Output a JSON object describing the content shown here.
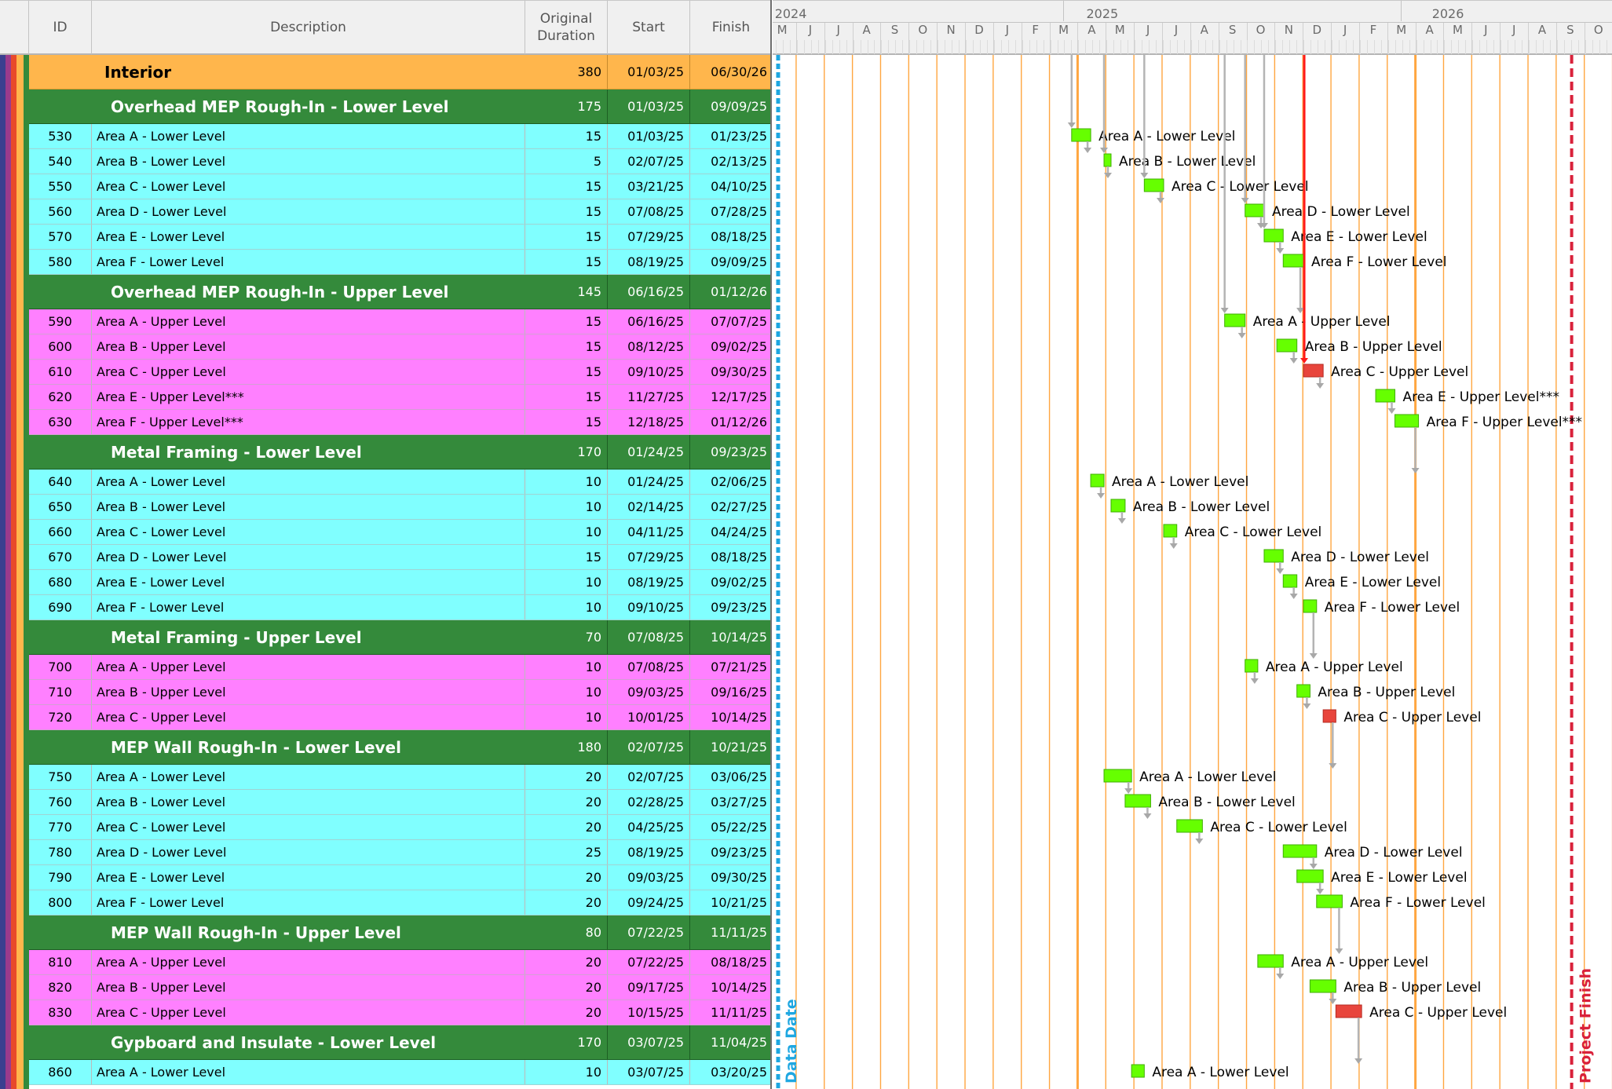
{
  "columns": {
    "id": "ID",
    "description": "Description",
    "duration_line1": "Original",
    "duration_line2": "Duration",
    "start": "Start",
    "finish": "Finish"
  },
  "timescale": {
    "years": [
      "2024",
      "2025",
      "2026"
    ],
    "months": [
      "M",
      "J",
      "J",
      "A",
      "S",
      "O",
      "N",
      "D",
      "J",
      "F",
      "M",
      "A",
      "M",
      "J",
      "J",
      "A",
      "S",
      "O",
      "N",
      "D",
      "J",
      "F",
      "M",
      "A",
      "M",
      "J",
      "J",
      "A",
      "S",
      "O"
    ]
  },
  "markers": {
    "data_date": "Data Date",
    "project_finish": "Project Finish"
  },
  "colors": {
    "wbs_level0": "#ffb64c",
    "wbs_level1": "#348a3b",
    "activity_lower": "#80ffff",
    "activity_upper": "#ff80ff",
    "bar_normal": "#66ff00",
    "bar_critical": "#e8453c",
    "data_date_line": "#1ea7e1",
    "project_finish_line": "#d9213a",
    "gridline": "#ffa640"
  },
  "rows": [
    {
      "type": "wbs0",
      "id": "",
      "description": "Interior",
      "duration": "380",
      "start": "01/03/25",
      "finish": "06/30/26"
    },
    {
      "type": "wbs1",
      "id": "",
      "description": "Overhead MEP Rough-In - Lower Level",
      "duration": "175",
      "start": "01/03/25",
      "finish": "09/09/25"
    },
    {
      "type": "act",
      "tone": "c",
      "id": "530",
      "description": "Area A - Lower Level",
      "duration": "15",
      "start": "01/03/25",
      "finish": "01/23/25",
      "critical": false
    },
    {
      "type": "act",
      "tone": "c",
      "id": "540",
      "description": "Area B - Lower Level",
      "duration": "5",
      "start": "02/07/25",
      "finish": "02/13/25",
      "critical": false
    },
    {
      "type": "act",
      "tone": "c",
      "id": "550",
      "description": "Area C - Lower Level",
      "duration": "15",
      "start": "03/21/25",
      "finish": "04/10/25",
      "critical": false
    },
    {
      "type": "act",
      "tone": "c",
      "id": "560",
      "description": "Area D - Lower Level",
      "duration": "15",
      "start": "07/08/25",
      "finish": "07/28/25",
      "critical": false
    },
    {
      "type": "act",
      "tone": "c",
      "id": "570",
      "description": "Area E - Lower Level",
      "duration": "15",
      "start": "07/29/25",
      "finish": "08/18/25",
      "critical": false
    },
    {
      "type": "act",
      "tone": "c",
      "id": "580",
      "description": "Area F - Lower Level",
      "duration": "15",
      "start": "08/19/25",
      "finish": "09/09/25",
      "critical": false
    },
    {
      "type": "wbs1",
      "id": "",
      "description": "Overhead MEP Rough-In - Upper Level",
      "duration": "145",
      "start": "06/16/25",
      "finish": "01/12/26"
    },
    {
      "type": "act",
      "tone": "m",
      "id": "590",
      "description": "Area A - Upper Level",
      "duration": "15",
      "start": "06/16/25",
      "finish": "07/07/25",
      "critical": false
    },
    {
      "type": "act",
      "tone": "m",
      "id": "600",
      "description": "Area B - Upper Level",
      "duration": "15",
      "start": "08/12/25",
      "finish": "09/02/25",
      "critical": false
    },
    {
      "type": "act",
      "tone": "m",
      "id": "610",
      "description": "Area C - Upper Level",
      "duration": "15",
      "start": "09/10/25",
      "finish": "09/30/25",
      "critical": true
    },
    {
      "type": "act",
      "tone": "m",
      "id": "620",
      "description": "Area E - Upper Level***",
      "duration": "15",
      "start": "11/27/25",
      "finish": "12/17/25",
      "critical": false
    },
    {
      "type": "act",
      "tone": "m",
      "id": "630",
      "description": "Area F - Upper Level***",
      "duration": "15",
      "start": "12/18/25",
      "finish": "01/12/26",
      "critical": false
    },
    {
      "type": "wbs1",
      "id": "",
      "description": "Metal Framing - Lower Level",
      "duration": "170",
      "start": "01/24/25",
      "finish": "09/23/25"
    },
    {
      "type": "act",
      "tone": "c",
      "id": "640",
      "description": "Area A - Lower Level",
      "duration": "10",
      "start": "01/24/25",
      "finish": "02/06/25",
      "critical": false
    },
    {
      "type": "act",
      "tone": "c",
      "id": "650",
      "description": "Area B - Lower Level",
      "duration": "10",
      "start": "02/14/25",
      "finish": "02/27/25",
      "critical": false
    },
    {
      "type": "act",
      "tone": "c",
      "id": "660",
      "description": "Area C - Lower Level",
      "duration": "10",
      "start": "04/11/25",
      "finish": "04/24/25",
      "critical": false
    },
    {
      "type": "act",
      "tone": "c",
      "id": "670",
      "description": "Area D - Lower Level",
      "duration": "15",
      "start": "07/29/25",
      "finish": "08/18/25",
      "critical": false
    },
    {
      "type": "act",
      "tone": "c",
      "id": "680",
      "description": "Area E - Lower Level",
      "duration": "10",
      "start": "08/19/25",
      "finish": "09/02/25",
      "critical": false
    },
    {
      "type": "act",
      "tone": "c",
      "id": "690",
      "description": "Area F - Lower Level",
      "duration": "10",
      "start": "09/10/25",
      "finish": "09/23/25",
      "critical": false
    },
    {
      "type": "wbs1",
      "id": "",
      "description": "Metal Framing - Upper Level",
      "duration": "70",
      "start": "07/08/25",
      "finish": "10/14/25"
    },
    {
      "type": "act",
      "tone": "m",
      "id": "700",
      "description": "Area A - Upper Level",
      "duration": "10",
      "start": "07/08/25",
      "finish": "07/21/25",
      "critical": false
    },
    {
      "type": "act",
      "tone": "m",
      "id": "710",
      "description": "Area B - Upper Level",
      "duration": "10",
      "start": "09/03/25",
      "finish": "09/16/25",
      "critical": false
    },
    {
      "type": "act",
      "tone": "m",
      "id": "720",
      "description": "Area C - Upper Level",
      "duration": "10",
      "start": "10/01/25",
      "finish": "10/14/25",
      "critical": true
    },
    {
      "type": "wbs1",
      "id": "",
      "description": "MEP Wall Rough-In - Lower Level",
      "duration": "180",
      "start": "02/07/25",
      "finish": "10/21/25"
    },
    {
      "type": "act",
      "tone": "c",
      "id": "750",
      "description": "Area A - Lower Level",
      "duration": "20",
      "start": "02/07/25",
      "finish": "03/06/25",
      "critical": false
    },
    {
      "type": "act",
      "tone": "c",
      "id": "760",
      "description": "Area B - Lower Level",
      "duration": "20",
      "start": "02/28/25",
      "finish": "03/27/25",
      "critical": false
    },
    {
      "type": "act",
      "tone": "c",
      "id": "770",
      "description": "Area C - Lower Level",
      "duration": "20",
      "start": "04/25/25",
      "finish": "05/22/25",
      "critical": false
    },
    {
      "type": "act",
      "tone": "c",
      "id": "780",
      "description": "Area D - Lower Level",
      "duration": "25",
      "start": "08/19/25",
      "finish": "09/23/25",
      "critical": false
    },
    {
      "type": "act",
      "tone": "c",
      "id": "790",
      "description": "Area E - Lower Level",
      "duration": "20",
      "start": "09/03/25",
      "finish": "09/30/25",
      "critical": false
    },
    {
      "type": "act",
      "tone": "c",
      "id": "800",
      "description": "Area F - Lower Level",
      "duration": "20",
      "start": "09/24/25",
      "finish": "10/21/25",
      "critical": false
    },
    {
      "type": "wbs1",
      "id": "",
      "description": "MEP Wall Rough-In - Upper Level",
      "duration": "80",
      "start": "07/22/25",
      "finish": "11/11/25"
    },
    {
      "type": "act",
      "tone": "m",
      "id": "810",
      "description": "Area A - Upper Level",
      "duration": "20",
      "start": "07/22/25",
      "finish": "08/18/25",
      "critical": false
    },
    {
      "type": "act",
      "tone": "m",
      "id": "820",
      "description": "Area B - Upper Level",
      "duration": "20",
      "start": "09/17/25",
      "finish": "10/14/25",
      "critical": false
    },
    {
      "type": "act",
      "tone": "m",
      "id": "830",
      "description": "Area C - Upper Level",
      "duration": "20",
      "start": "10/15/25",
      "finish": "11/11/25",
      "critical": true
    },
    {
      "type": "wbs1",
      "id": "",
      "description": "Gypboard and Insulate - Lower Level",
      "duration": "170",
      "start": "03/07/25",
      "finish": "11/04/25"
    },
    {
      "type": "act",
      "tone": "c",
      "id": "860",
      "description": "Area A - Lower Level",
      "duration": "10",
      "start": "03/07/25",
      "finish": "03/20/25",
      "critical": false
    }
  ]
}
